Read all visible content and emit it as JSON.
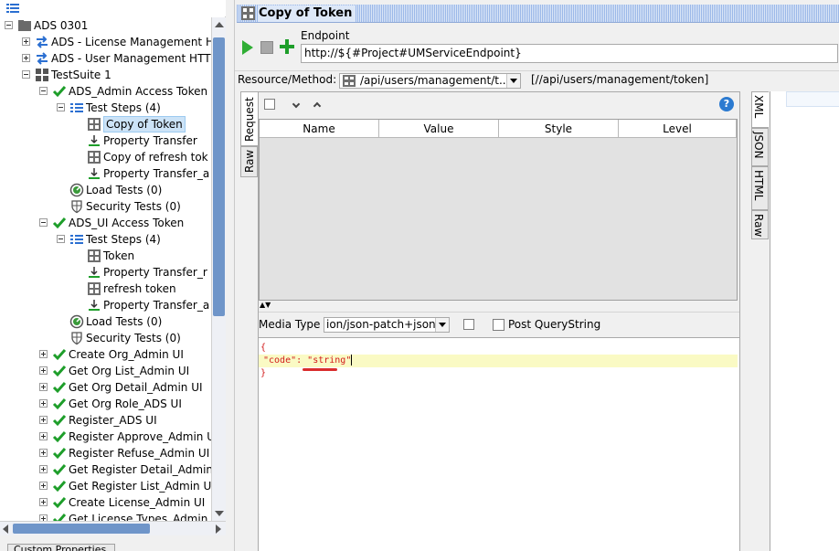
{
  "tree": [
    {
      "label": "ADS 0301",
      "level": 0,
      "expander": "minus",
      "icon": "folder-icon"
    },
    {
      "label": "ADS - License Management H",
      "level": 1,
      "expander": "plus",
      "icon": "arrows-exchange-icon"
    },
    {
      "label": "ADS - User Management HTT",
      "level": 1,
      "expander": "plus",
      "icon": "arrows-exchange-icon"
    },
    {
      "label": "TestSuite 1",
      "level": 1,
      "expander": "minus",
      "icon": "grid-icon"
    },
    {
      "label": "ADS_Admin Access Token",
      "level": 2,
      "expander": "minus",
      "icon": "check-icon"
    },
    {
      "label": "Test Steps (4)",
      "level": 3,
      "expander": "minus",
      "icon": "list-icon"
    },
    {
      "label": "Copy of Token",
      "level": 4,
      "expander": "",
      "icon": "request-icon",
      "selected": true
    },
    {
      "label": "Property Transfer",
      "level": 4,
      "expander": "",
      "icon": "transfer-icon"
    },
    {
      "label": "Copy of refresh tok",
      "level": 4,
      "expander": "",
      "icon": "request-icon"
    },
    {
      "label": "Property Transfer_a",
      "level": 4,
      "expander": "",
      "icon": "transfer-icon"
    },
    {
      "label": "Load Tests (0)",
      "level": 3,
      "expander": "",
      "icon": "gauge-icon"
    },
    {
      "label": "Security Tests (0)",
      "level": 3,
      "expander": "",
      "icon": "shield-icon"
    },
    {
      "label": "ADS_UI Access Token",
      "level": 2,
      "expander": "minus",
      "icon": "check-icon"
    },
    {
      "label": "Test Steps (4)",
      "level": 3,
      "expander": "minus",
      "icon": "list-icon"
    },
    {
      "label": "Token",
      "level": 4,
      "expander": "",
      "icon": "request-icon"
    },
    {
      "label": "Property Transfer_r",
      "level": 4,
      "expander": "",
      "icon": "transfer-icon"
    },
    {
      "label": "refresh token",
      "level": 4,
      "expander": "",
      "icon": "request-icon"
    },
    {
      "label": "Property Transfer_a",
      "level": 4,
      "expander": "",
      "icon": "transfer-icon"
    },
    {
      "label": "Load Tests (0)",
      "level": 3,
      "expander": "",
      "icon": "gauge-icon"
    },
    {
      "label": "Security Tests (0)",
      "level": 3,
      "expander": "",
      "icon": "shield-icon"
    },
    {
      "label": "Create Org_Admin UI",
      "level": 2,
      "expander": "plus",
      "icon": "check-icon"
    },
    {
      "label": "Get Org List_Admin UI",
      "level": 2,
      "expander": "plus",
      "icon": "check-icon"
    },
    {
      "label": "Get Org Detail_Admin UI",
      "level": 2,
      "expander": "plus",
      "icon": "check-icon"
    },
    {
      "label": "Get Org Role_ADS UI",
      "level": 2,
      "expander": "plus",
      "icon": "check-icon"
    },
    {
      "label": "Register_ADS UI",
      "level": 2,
      "expander": "plus",
      "icon": "check-icon"
    },
    {
      "label": "Register Approve_Admin U",
      "level": 2,
      "expander": "plus",
      "icon": "check-icon"
    },
    {
      "label": "Register Refuse_Admin UI",
      "level": 2,
      "expander": "plus",
      "icon": "check-icon"
    },
    {
      "label": "Get Register Detail_Admin",
      "level": 2,
      "expander": "plus",
      "icon": "check-icon"
    },
    {
      "label": "Get Register List_Admin UI",
      "level": 2,
      "expander": "plus",
      "icon": "check-icon"
    },
    {
      "label": "Create License_Admin UI",
      "level": 2,
      "expander": "plus",
      "icon": "check-icon"
    },
    {
      "label": "Get License Types_Admin U",
      "level": 2,
      "expander": "plus",
      "icon": "check-icon"
    }
  ],
  "bottom_tab": "Custom Properties",
  "title": "Copy of Token",
  "endpoint": {
    "label": "Endpoint",
    "value": "http://${#Project#UMServiceEndpoint}"
  },
  "resource": {
    "label": "Resource/Method:",
    "value": "/api/users/management/t...",
    "path": "[//api/users/management/token]"
  },
  "request_tabs": [
    "Request",
    "Raw"
  ],
  "response_tabs": [
    "XML",
    "JSON",
    "HTML",
    "Raw"
  ],
  "grid_columns": [
    "Name",
    "Value",
    "Style",
    "Level"
  ],
  "media": {
    "label": "Media Type",
    "value": "ion/json-patch+json",
    "post_qs": "Post QueryString"
  },
  "body": {
    "open": "{",
    "key": "\"code\"",
    "colon": ": ",
    "value": "\"string\"",
    "close": "}"
  },
  "colors": {
    "accent_blue": "#2b7ad0",
    "check_green": "#1e9e2a",
    "selection": "#cce3f7",
    "json_red": "#d21c1c",
    "highlight_line": "#fafac4"
  }
}
